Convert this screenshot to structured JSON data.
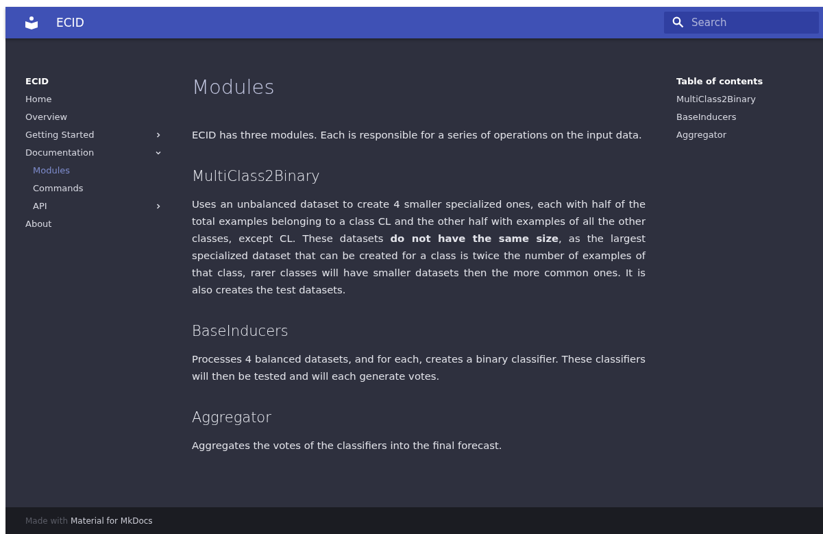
{
  "header": {
    "title": "ECID",
    "search": {
      "placeholder": "Search"
    }
  },
  "nav": {
    "title": "ECID",
    "items": [
      {
        "kind": "link",
        "label": "Home",
        "selected": false
      },
      {
        "kind": "link",
        "label": "Overview",
        "selected": false
      },
      {
        "kind": "section",
        "label": "Getting Started",
        "expanded": false
      },
      {
        "kind": "section",
        "label": "Documentation",
        "expanded": true,
        "children": [
          {
            "kind": "link",
            "label": "Modules",
            "selected": true
          },
          {
            "kind": "link",
            "label": "Commands",
            "selected": false
          },
          {
            "kind": "section",
            "label": "API",
            "expanded": false
          }
        ]
      },
      {
        "kind": "link",
        "label": "About",
        "selected": false
      }
    ]
  },
  "content": {
    "title": "Modules",
    "intro": "ECID has three modules. Each is responsible for a series of operations on the input data.",
    "sections": [
      {
        "heading": "MultiClass2Binary",
        "text": "Uses an unbalanced dataset to create 4 smaller specialized ones, each with half of the total examples belonging to a class CL and the other half with examples of all the other classes, except CL. These datasets **do not have the same size**, as the largest specialized dataset that can be created for a class is twice the number of examples of that class, rarer classes will have smaller datasets then the more common ones. It is also creates the test datasets."
      },
      {
        "heading": "BaseInducers",
        "text": "Processes 4 balanced datasets, and for each, creates a binary classifier. These classifiers will then be tested and will each generate votes."
      },
      {
        "heading": "Aggregator",
        "text": "Aggregates the votes of the classifiers into the final forecast."
      }
    ]
  },
  "toc": {
    "title": "Table of contents",
    "items": [
      "MultiClass2Binary",
      "BaseInducers",
      "Aggregator"
    ]
  },
  "footer": {
    "prefix": "Made with",
    "link": "Material for MkDocs"
  }
}
